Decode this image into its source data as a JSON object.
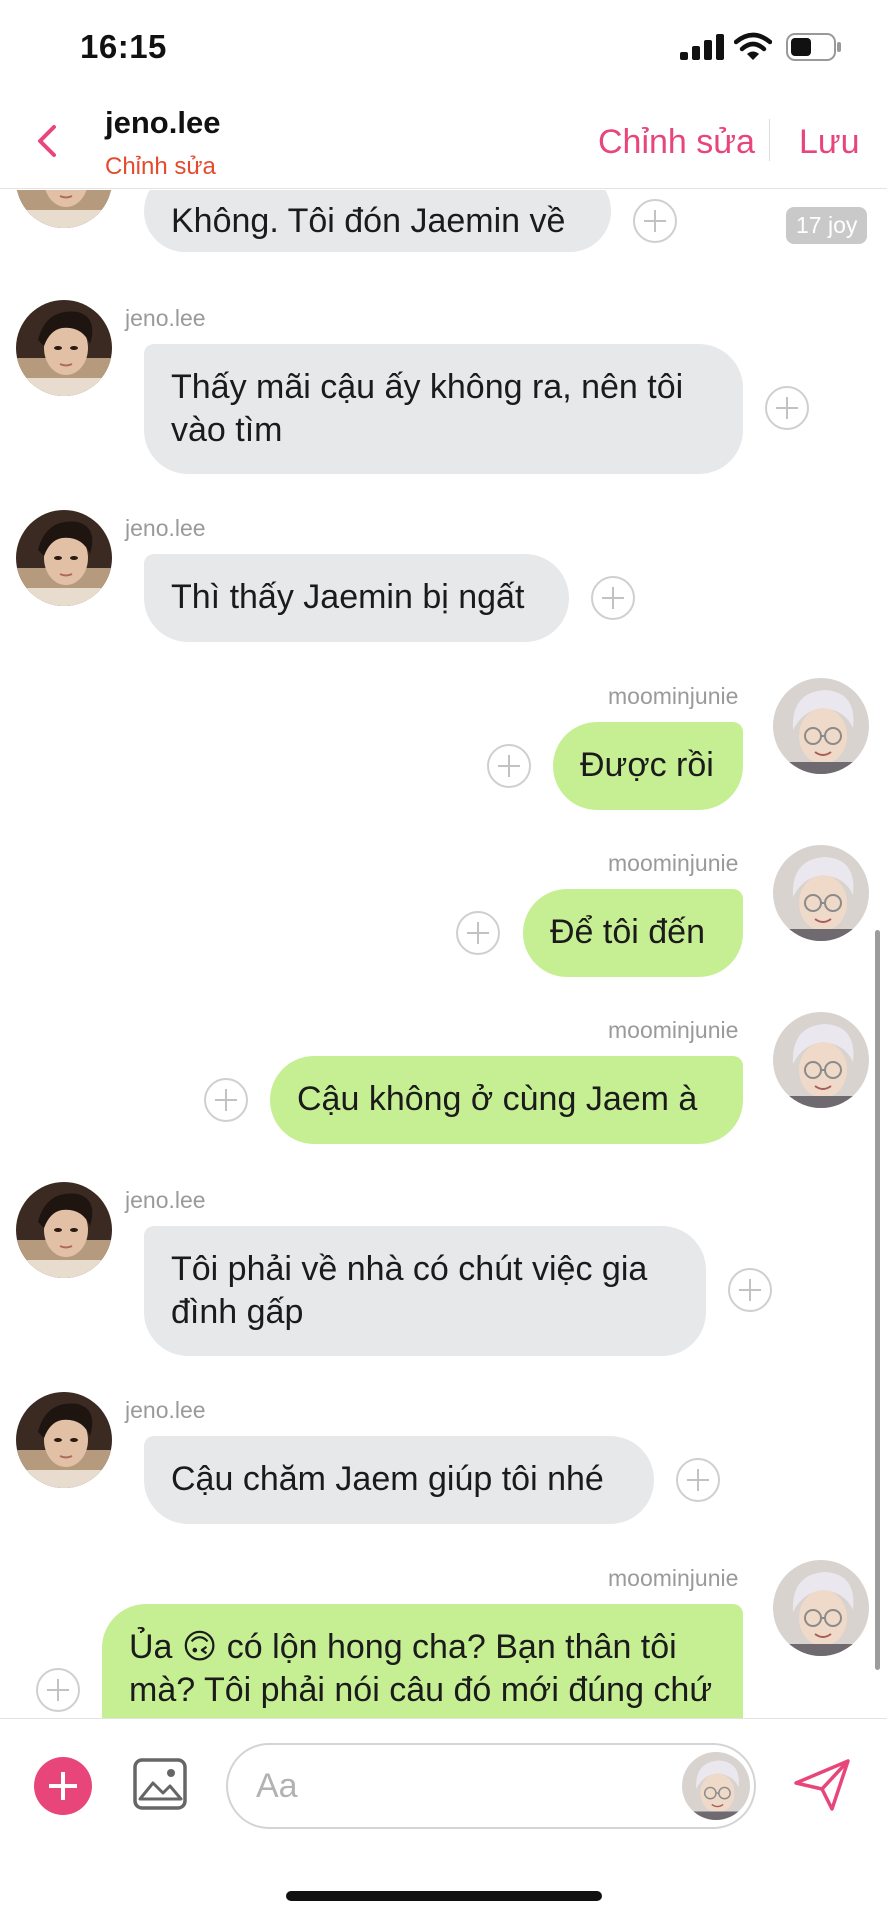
{
  "status_bar": {
    "time": "16:15"
  },
  "header": {
    "name": "jeno.lee",
    "subtitle": "Chỉnh sửa",
    "edit_label": "Chỉnh sửa",
    "save_label": "Lưu"
  },
  "messages": [
    {
      "side": "in",
      "user": "",
      "text": "Không. Tôi đón Jaemin về",
      "badge": "17 joy"
    },
    {
      "side": "in",
      "user": "jeno.lee",
      "text": "Thấy mãi cậu ấy không ra, nên tôi vào tìm"
    },
    {
      "side": "in",
      "user": "jeno.lee",
      "text": "Thì thấy Jaemin bị ngất"
    },
    {
      "side": "out",
      "user": "moominjunie",
      "text": "Được rồi"
    },
    {
      "side": "out",
      "user": "moominjunie",
      "text": "Để tôi đến"
    },
    {
      "side": "out",
      "user": "moominjunie",
      "text": "Cậu không ở cùng Jaem à"
    },
    {
      "side": "in",
      "user": "jeno.lee",
      "text": "Tôi phải về nhà có chút việc gia đình gấp"
    },
    {
      "side": "in",
      "user": "jeno.lee",
      "text": "Cậu chăm Jaem giúp tôi nhé"
    },
    {
      "side": "out",
      "user": "moominjunie",
      "text": "Ủa 🙃 có lộn hong cha? Bạn thân tôi mà? Tôi phải nói câu đó mới đúng chứ"
    }
  ],
  "composer": {
    "placeholder": "Aa"
  },
  "icons": {
    "back": "chevron-left-icon",
    "add": "plus-icon",
    "image": "image-icon",
    "send": "send-icon",
    "react": "plus-circle-icon"
  },
  "colors": {
    "accent": "#e8467a",
    "incoming_bubble": "#e6e8ea",
    "outgoing_bubble": "#c6ef93",
    "subtitle": "#e64a2e"
  }
}
